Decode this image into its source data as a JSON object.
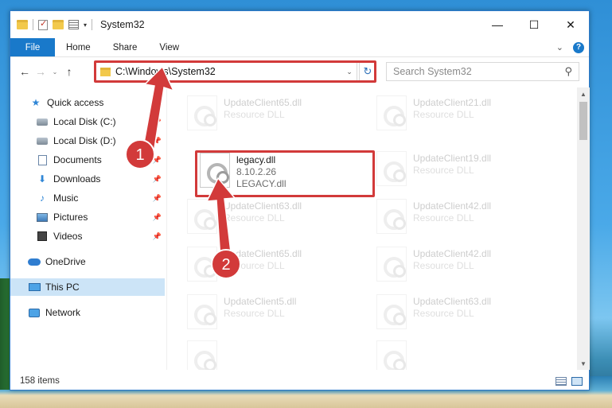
{
  "window": {
    "title": "System32",
    "controls": {
      "minimize": "—",
      "maximize": "☐",
      "close": "✕"
    }
  },
  "ribbon": {
    "tabs": [
      "File",
      "Home",
      "Share",
      "View"
    ]
  },
  "address_bar": {
    "path": "C:\\Windows\\System32"
  },
  "search": {
    "placeholder": "Search System32"
  },
  "nav_pane": {
    "items": [
      {
        "label": "Quick access",
        "icon": "star-icon",
        "pinned": false
      },
      {
        "label": "Local Disk (C:)",
        "icon": "disk-icon",
        "pinned": true
      },
      {
        "label": "Local Disk (D:)",
        "icon": "disk-icon",
        "pinned": true
      },
      {
        "label": "Documents",
        "icon": "documents-icon",
        "pinned": true
      },
      {
        "label": "Downloads",
        "icon": "downloads-icon",
        "pinned": true
      },
      {
        "label": "Music",
        "icon": "music-icon",
        "pinned": true
      },
      {
        "label": "Pictures",
        "icon": "pictures-icon",
        "pinned": true
      },
      {
        "label": "Videos",
        "icon": "videos-icon",
        "pinned": true
      },
      {
        "label": "OneDrive",
        "icon": "onedrive-icon",
        "pinned": false
      },
      {
        "label": "This PC",
        "icon": "this-pc-icon",
        "pinned": false,
        "selected": true
      },
      {
        "label": "Network",
        "icon": "network-icon",
        "pinned": false
      }
    ]
  },
  "files": {
    "highlighted": {
      "name": "legacy.dll",
      "version": "8.10.2.26",
      "description": "LEGACY.dll"
    },
    "background_items": [
      {
        "name": "UpdateClient65.dll",
        "type": "Resource DLL"
      },
      {
        "name": "UpdateClient21.dll",
        "type": "Resource DLL"
      },
      {
        "name": "UpdateClient19.dll",
        "type": "Resource DLL"
      },
      {
        "name": "UpdateClient63.dll",
        "type": "Resource DLL"
      },
      {
        "name": "UpdateClient42.dll",
        "type": "Resource DLL"
      },
      {
        "name": "UpdateClient65.dll",
        "type": "Resource DLL"
      },
      {
        "name": "UpdateClient42.dll",
        "type": "Resource DLL"
      },
      {
        "name": "UpdateClient5.dll",
        "type": "Resource DLL"
      },
      {
        "name": "UpdateClient63.dll",
        "type": "Resource DLL"
      }
    ]
  },
  "status_bar": {
    "item_count": "158 items"
  },
  "annotations": {
    "step1": "1",
    "step2": "2",
    "color": "#d23a3a"
  }
}
